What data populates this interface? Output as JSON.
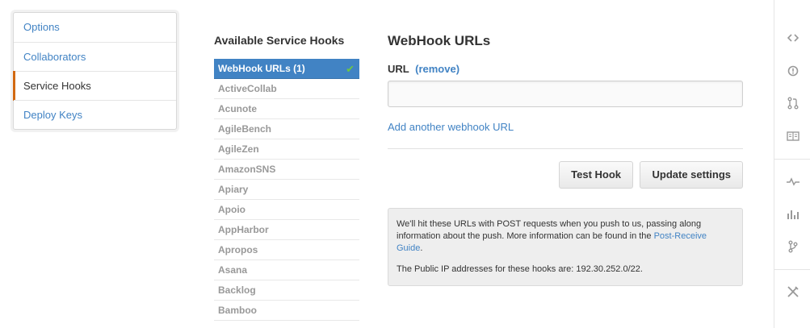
{
  "settings_menu": {
    "items": [
      {
        "label": "Options"
      },
      {
        "label": "Collaborators"
      },
      {
        "label": "Service Hooks"
      },
      {
        "label": "Deploy Keys"
      }
    ]
  },
  "hooks": {
    "title": "Available Service Hooks",
    "items": [
      {
        "label": "WebHook URLs (1)",
        "active": true
      },
      {
        "label": "ActiveCollab"
      },
      {
        "label": "Acunote"
      },
      {
        "label": "AgileBench"
      },
      {
        "label": "AgileZen"
      },
      {
        "label": "AmazonSNS"
      },
      {
        "label": "Apiary"
      },
      {
        "label": "Apoio"
      },
      {
        "label": "AppHarbor"
      },
      {
        "label": "Apropos"
      },
      {
        "label": "Asana"
      },
      {
        "label": "Backlog"
      },
      {
        "label": "Bamboo"
      }
    ]
  },
  "webhook": {
    "title": "WebHook URLs",
    "url_label": "URL",
    "remove_link": "(remove)",
    "url_value": "",
    "add_link": "Add another webhook URL",
    "test_button": "Test Hook",
    "update_button": "Update settings",
    "info_line1": "We'll hit these URLs with POST requests when you push to us, passing along information about the push. More information can be found in the ",
    "info_link": "Post-Receive Guide",
    "info_line1_end": ".",
    "info_line2": "The Public IP addresses for these hooks are: 192.30.252.0/22."
  },
  "rail": {
    "icons": [
      "code-icon",
      "issues-icon",
      "pull-request-icon",
      "wiki-icon",
      "pulse-icon",
      "graphs-icon",
      "network-icon",
      "settings-tools-icon"
    ],
    "icon_color": "#999999"
  },
  "colors": {
    "link": "#4183c4",
    "active_hook": "#4183c4",
    "selected_menu_accent": "#d26911",
    "check": "#6cc644"
  }
}
